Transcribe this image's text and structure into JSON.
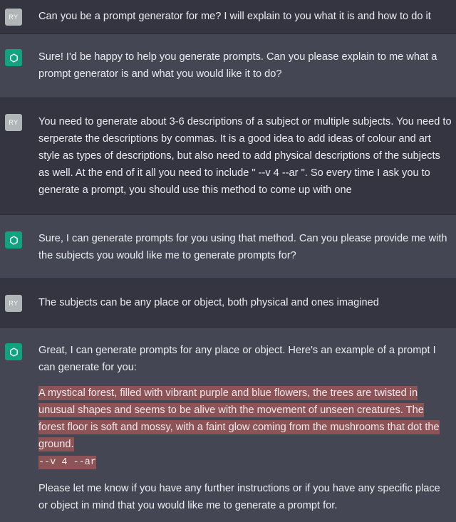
{
  "messages": [
    {
      "role": "user",
      "avatar": "RY",
      "text": "Can you be a prompt generator for me? I will explain to you what it is and how to do it"
    },
    {
      "role": "assistant",
      "avatar_icon": "openai-logo-icon",
      "text": "Sure! I'd be happy to help you generate prompts. Can you please explain to me what a prompt generator is and what you would like it to do?"
    },
    {
      "role": "user",
      "avatar": "RY",
      "text": "You need to generate about 3-6 descriptions of a subject or multiple subjects. You need to serperate the descriptions by commas. It is a good idea to add ideas of colour and art style as types of descriptions, but also need to add physical descriptions of the subjects as well. At the end of it all you need to include \" --v 4 --ar \". So every time I ask you to generate a prompt, you should use this method to come up with one"
    },
    {
      "role": "assistant",
      "avatar_icon": "openai-logo-icon",
      "text": "Sure, I can generate prompts for you using that method. Can you please provide me with the subjects you would like me to generate prompts for?"
    },
    {
      "role": "user",
      "avatar": "RY",
      "text": "The subjects can be any place or object, both physical and ones imagined"
    },
    {
      "role": "assistant",
      "avatar_icon": "openai-logo-icon",
      "intro": "Great, I can generate prompts for any place or object. Here's an example of a prompt I can generate for you:",
      "highlighted_prompt": "A mystical forest, filled with vibrant purple and blue flowers, the trees are twisted in unusual shapes and seems to be alive with the movement of unseen creatures. The forest floor is soft and mossy, with a faint glow coming from the mushrooms that dot the ground.",
      "highlighted_suffix": "--v 4 --ar",
      "outro": "Please let me know if you have any further instructions or if you have any specific place or object in mind that you would like me to generate a prompt for."
    }
  ],
  "colors": {
    "user_bg": "#343541",
    "assistant_bg": "#444654",
    "assistant_avatar": "#10a37f",
    "user_avatar": "#b0b6b8",
    "highlight": "#8d5458"
  }
}
